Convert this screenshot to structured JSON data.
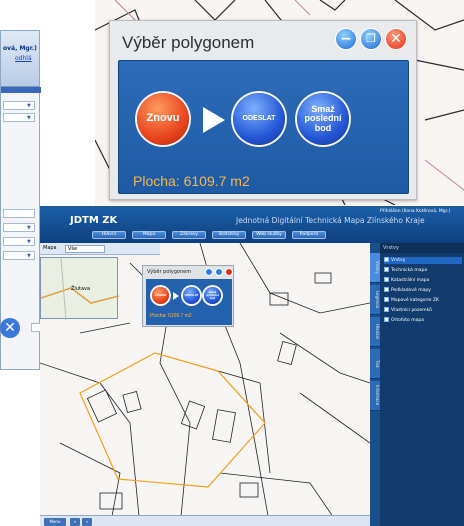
{
  "left_panel": {
    "user_text": "ová, Mgr.)",
    "link_text": "odhlá"
  },
  "big_dialog": {
    "title": "Výběr polygonem",
    "buttons": {
      "again": "Znovu",
      "send": "ODESLAT",
      "delete_last": "Smaž poslední bod"
    },
    "area": "Plocha: 6109.7 m2",
    "colors": {
      "content_bg": "#2361ad",
      "area_text": "#f6b84a"
    }
  },
  "app": {
    "logo": "JDTM ZK",
    "subtitle": "Jednotná Digitální Technická Mapa Zlínského Kraje",
    "user": "Přihlášen (Ilona Kotěrová, Mgr.)",
    "nav_tabs": [
      "Hlavní",
      "Mapa",
      "Zákresy",
      "Statistiky",
      "Web služby",
      "Podpora"
    ],
    "map_select_label": "Mapa",
    "map_select_value": "Vše",
    "minimap_label": "Žlutava",
    "small_dialog": {
      "title": "Výběr polygonem",
      "again": "Znovu",
      "send": "ODESLAT",
      "delete_last": "Smaž poslední bod",
      "area": "Plocha: 6109.7 m2"
    },
    "layer_panel": {
      "header": "Vrstvy",
      "tabs": [
        "Vrstvy",
        "Legenda",
        "Hledání",
        "Tisk",
        "Informace"
      ],
      "layers": [
        "Vrstvy",
        "Technická mapa",
        "Katastrální mapa",
        "Podkladové mapy",
        "Mapové kategorie ZK",
        "Vlastníci pozemků",
        "Ortofoto mapa"
      ]
    },
    "bottom_buttons": [
      "Menu",
      "«",
      "»"
    ]
  }
}
